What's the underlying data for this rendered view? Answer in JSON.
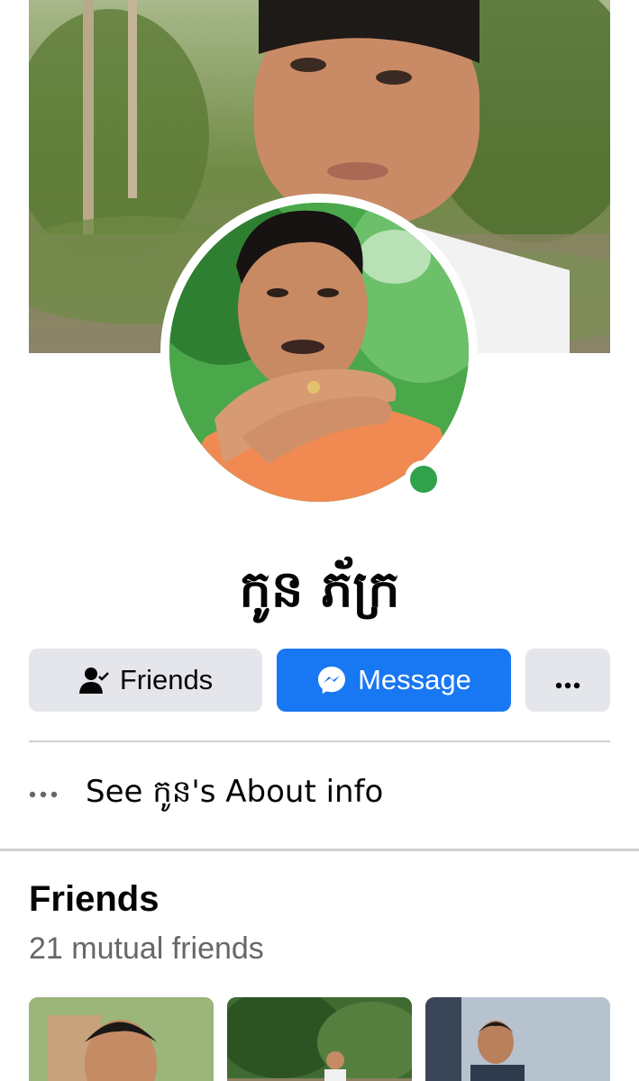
{
  "profile": {
    "name": "កូន ភ័ក្រ",
    "online": true,
    "colors": {
      "online": "#31a24c"
    }
  },
  "actions": {
    "friends_label": "Friends",
    "message_label": "Message",
    "more_label": "more",
    "colors": {
      "primary": "#1877f2",
      "secondary": "#e4e6eb"
    },
    "icons": [
      "friend-check-icon",
      "messenger-icon",
      "more-dots-icon"
    ]
  },
  "about": {
    "label": "See កូន's About info",
    "icon": "more-dots-icon"
  },
  "friends": {
    "title": "Friends",
    "mutual": "21 mutual friends",
    "thumbnails": 3
  }
}
